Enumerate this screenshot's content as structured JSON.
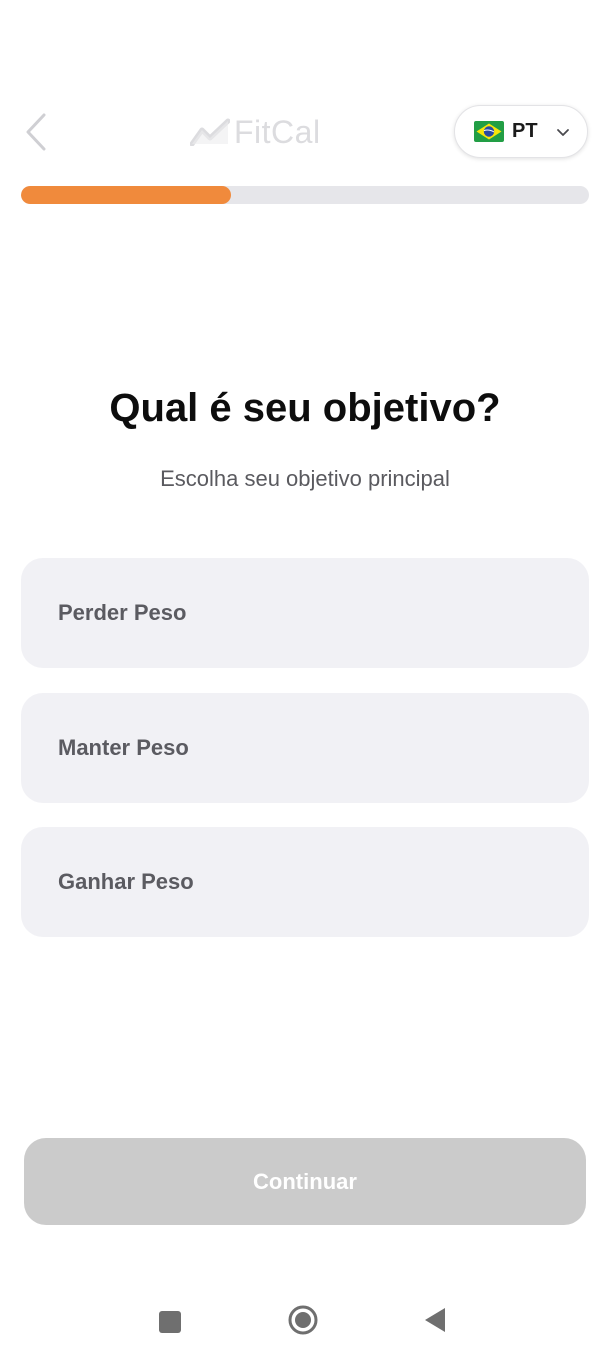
{
  "header": {
    "back_icon": "chevron-left-icon",
    "logo_icon": "trend-line-icon",
    "logo_text": "FitCal",
    "language": {
      "flag_icon": "brazil-flag-icon",
      "code": "PT",
      "chevron_icon": "chevron-down-icon"
    }
  },
  "progress": {
    "value": 0.37,
    "fill_color": "#f08a3c",
    "track_color": "#e6e6ea"
  },
  "main": {
    "title": "Qual é seu objetivo?",
    "subtitle": "Escolha seu objetivo principal",
    "options": [
      {
        "label": "Perder Peso"
      },
      {
        "label": "Manter Peso"
      },
      {
        "label": "Ganhar Peso"
      }
    ]
  },
  "footer": {
    "continue_label": "Continuar"
  },
  "system_nav": {
    "recent_icon": "square-icon",
    "home_icon": "circle-home-icon",
    "back_icon": "triangle-back-icon"
  },
  "colors": {
    "accent": "#f08a3c",
    "option_bg": "#f1f1f5",
    "button_disabled": "#cbcbcb"
  }
}
